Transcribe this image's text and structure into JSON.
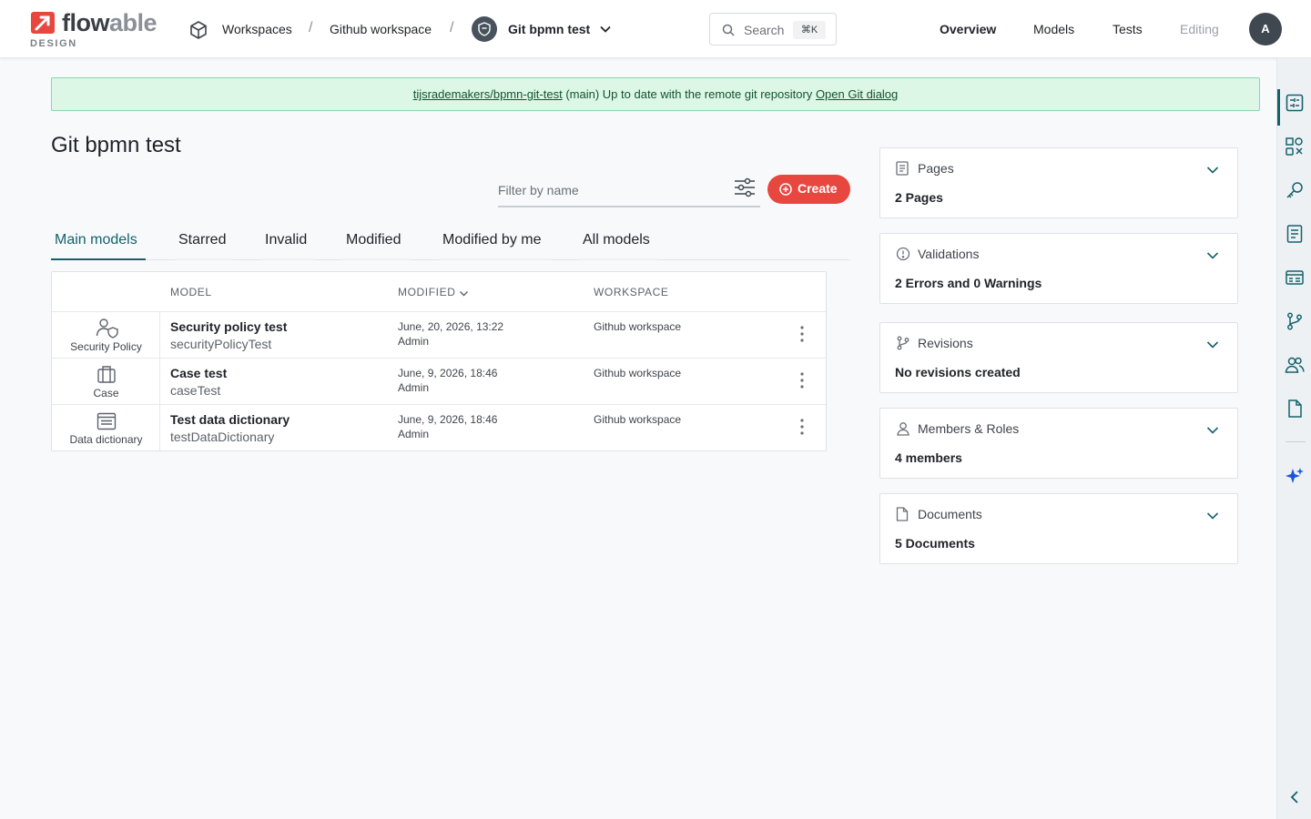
{
  "app": {
    "logo_word_a": "flow",
    "logo_word_b": "able",
    "logo_sub": "DESIGN",
    "brand_color": "#e8473f",
    "accent_color": "#12626c"
  },
  "breadcrumb": {
    "workspaces": "Workspaces",
    "workspace": "Github workspace",
    "app": "Git bpmn test",
    "separator": "/"
  },
  "search": {
    "label": "Search",
    "shortcut": "⌘K"
  },
  "nav": {
    "overview": "Overview",
    "models": "Models",
    "tests": "Tests",
    "editing": "Editing",
    "avatar": "A"
  },
  "banner": {
    "repo": "tijsrademakers/bpmn-git-test",
    "branch": "(main)",
    "message": "Up to date with the remote git repository",
    "link": "Open Git dialog"
  },
  "page": {
    "title": "Git bpmn test"
  },
  "filter": {
    "placeholder": "Filter by name"
  },
  "create": {
    "label": "Create"
  },
  "tabs": [
    "Main models",
    "Starred",
    "Invalid",
    "Modified",
    "Modified by me",
    "All models"
  ],
  "table": {
    "headers": {
      "model": "MODEL",
      "modified": "MODIFIED",
      "workspace": "WORKSPACE"
    },
    "rows": [
      {
        "type": "Security Policy",
        "name": "Security policy test",
        "key": "securityPolicyTest",
        "date": "June, 20, 2026, 13:22",
        "user": "Admin",
        "workspace": "Github workspace",
        "icon": "security-policy-icon"
      },
      {
        "type": "Case",
        "name": "Case test",
        "key": "caseTest",
        "date": "June, 9, 2026, 18:46",
        "user": "Admin",
        "workspace": "Github workspace",
        "icon": "case-icon"
      },
      {
        "type": "Data dictionary",
        "name": "Test data dictionary",
        "key": "testDataDictionary",
        "date": "June, 9, 2026, 18:46",
        "user": "Admin",
        "workspace": "Github workspace",
        "icon": "data-dictionary-icon"
      }
    ]
  },
  "cards": [
    {
      "title": "Pages",
      "value": "2 Pages",
      "icon": "pages-icon"
    },
    {
      "title": "Validations",
      "value": "2 Errors and 0 Warnings",
      "icon": "validation-icon"
    },
    {
      "title": "Revisions",
      "value": "No revisions created",
      "icon": "revisions-icon"
    },
    {
      "title": "Members & Roles",
      "value": "4 members",
      "icon": "member-icon"
    },
    {
      "title": "Documents",
      "value": "5 Documents",
      "icon": "document-icon"
    }
  ],
  "rail": [
    "app-properties-icon",
    "components-icon",
    "key-icon",
    "form-icon",
    "data-icon",
    "git-branch-icon",
    "users-icon",
    "file-icon",
    "ai-sparkle-icon",
    "collapse-icon"
  ]
}
